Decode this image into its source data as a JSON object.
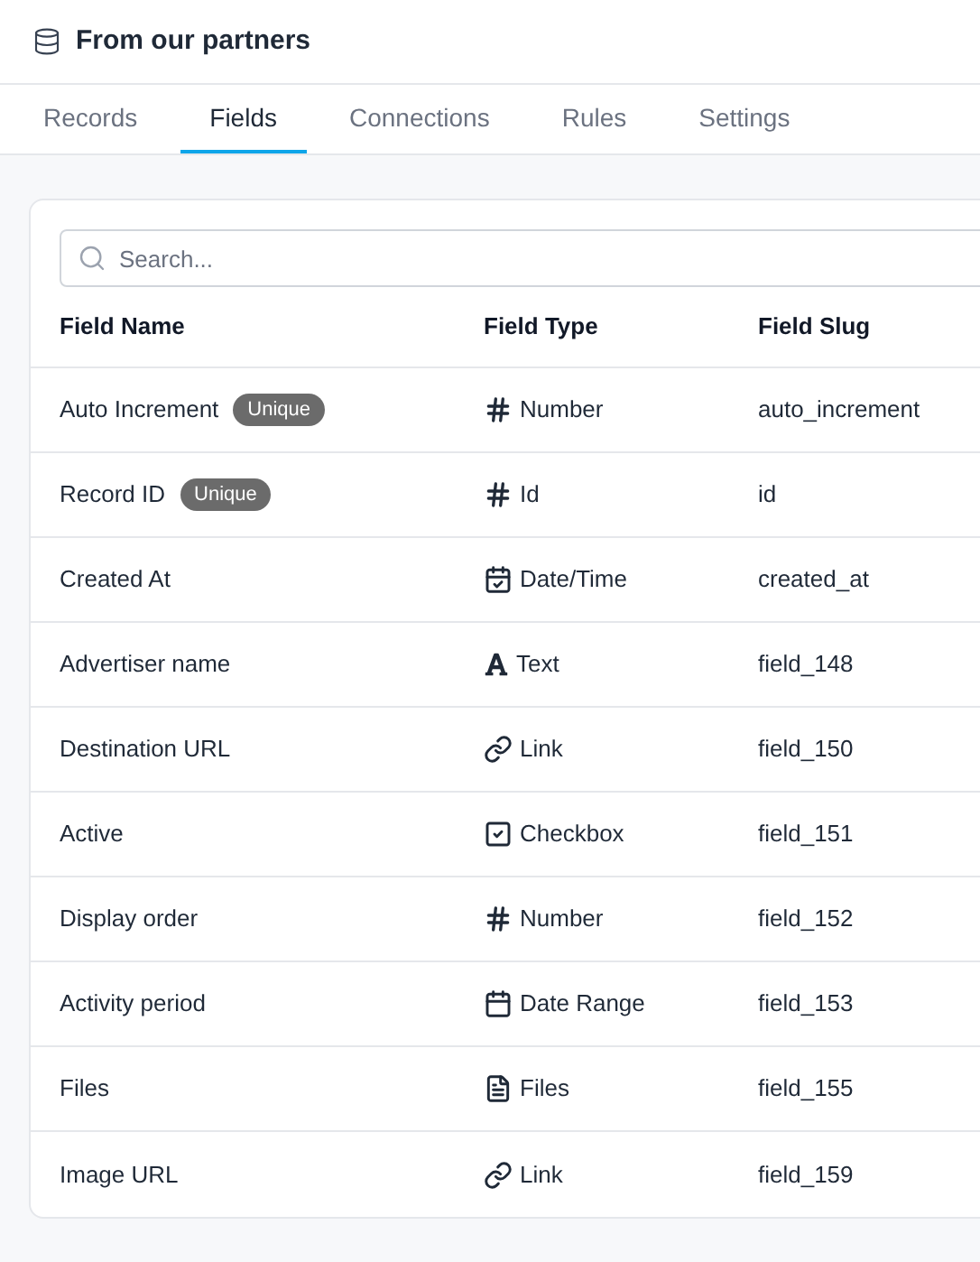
{
  "header": {
    "title": "From our partners"
  },
  "tabs": [
    {
      "label": "Records",
      "selected": false
    },
    {
      "label": "Fields",
      "selected": true
    },
    {
      "label": "Connections",
      "selected": false
    },
    {
      "label": "Rules",
      "selected": false
    },
    {
      "label": "Settings",
      "selected": false
    }
  ],
  "search": {
    "placeholder": "Search..."
  },
  "table": {
    "columns": [
      "Field Name",
      "Field Type",
      "Field Slug"
    ],
    "rows": [
      {
        "name": "Auto Increment",
        "badge": "Unique",
        "type": "Number",
        "kind": "number",
        "slug": "auto_increment"
      },
      {
        "name": "Record ID",
        "badge": "Unique",
        "type": "Id",
        "kind": "number",
        "slug": "id"
      },
      {
        "name": "Created At",
        "type": "Date/Time",
        "kind": "datetime",
        "slug": "created_at"
      },
      {
        "name": "Advertiser name",
        "type": "Text",
        "kind": "text",
        "slug": "field_148"
      },
      {
        "name": "Destination URL",
        "type": "Link",
        "kind": "link",
        "slug": "field_150"
      },
      {
        "name": "Active",
        "type": "Checkbox",
        "kind": "checkbox",
        "slug": "field_151"
      },
      {
        "name": "Display order",
        "type": "Number",
        "kind": "number",
        "slug": "field_152"
      },
      {
        "name": "Activity period",
        "type": "Date Range",
        "kind": "daterange",
        "slug": "field_153"
      },
      {
        "name": "Files",
        "type": "Files",
        "kind": "files",
        "slug": "field_155"
      },
      {
        "name": "Image URL",
        "type": "Link",
        "kind": "link",
        "slug": "field_159"
      }
    ]
  }
}
